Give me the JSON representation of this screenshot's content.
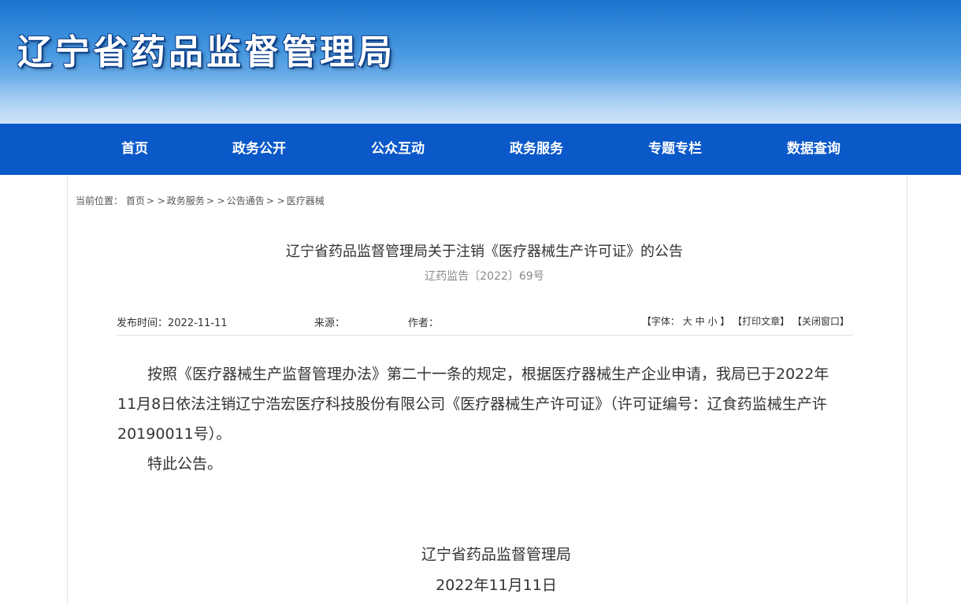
{
  "site": {
    "title": "辽宁省药品监督管理局"
  },
  "nav": {
    "items": [
      {
        "label": "首页"
      },
      {
        "label": "政务公开"
      },
      {
        "label": "公众互动"
      },
      {
        "label": "政务服务"
      },
      {
        "label": "专题专栏"
      },
      {
        "label": "数据查询"
      }
    ]
  },
  "breadcrumb": {
    "prefix": "当前位置：",
    "items": [
      "首页",
      "政务服务",
      "公告通告",
      "医疗器械"
    ],
    "separator": "> >"
  },
  "article": {
    "title": "辽宁省药品监督管理局关于注销《医疗器械生产许可证》的公告",
    "doc_number": "辽药监告〔2022〕69号",
    "meta": {
      "publish_label": "发布时间：",
      "publish_date": "2022-11-11",
      "source_label": "来源：",
      "author_label": "作者："
    },
    "tools": {
      "font_open": "【字体：",
      "font_large": "大",
      "font_medium": "中",
      "font_small": "小",
      "font_close": "】",
      "print": "【打印文章】",
      "close": "【关闭窗口】"
    },
    "paragraphs": [
      "按照《医疗器械生产监督管理办法》第二十一条的规定，根据医疗器械生产企业申请，我局已于2022年11月8日依法注销辽宁浩宏医疗科技股份有限公司《医疗器械生产许可证》（许可证编号：辽食药监械生产许20190011号）。",
      "特此公告。"
    ],
    "signature": {
      "org": "辽宁省药品监督管理局",
      "date": "2022年11月11日"
    }
  },
  "colors": {
    "nav_bg": "#0b59c9",
    "banner_top": "#1a73cf",
    "banner_bottom": "#b8d8f5"
  }
}
